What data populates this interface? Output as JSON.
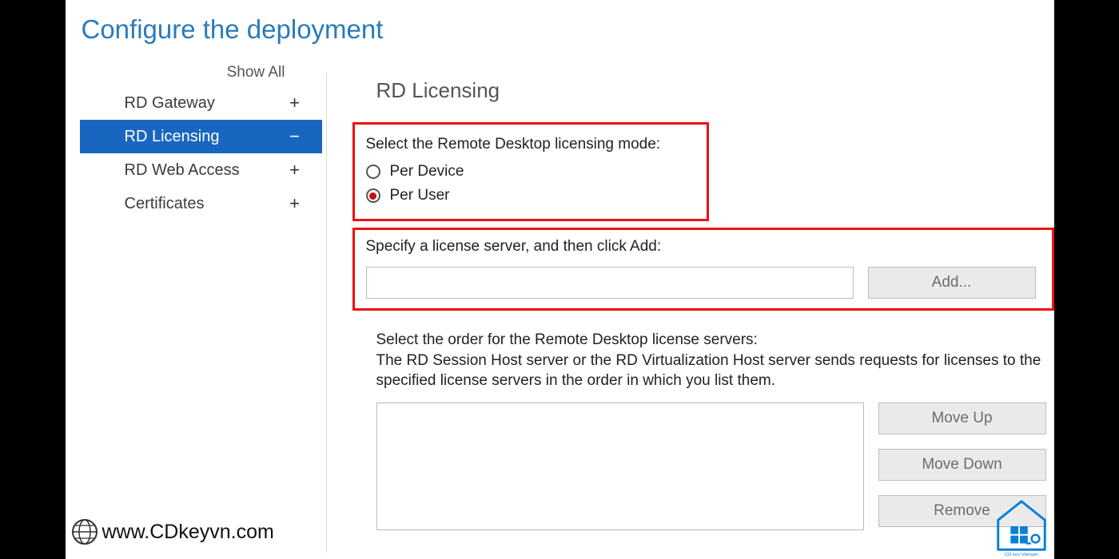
{
  "title": "Configure the deployment",
  "sidebar": {
    "show_all": "Show All",
    "items": [
      {
        "label": "RD Gateway",
        "toggle": "+",
        "active": false
      },
      {
        "label": "RD Licensing",
        "toggle": "−",
        "active": true
      },
      {
        "label": "RD Web Access",
        "toggle": "+",
        "active": false
      },
      {
        "label": "Certificates",
        "toggle": "+",
        "active": false
      }
    ]
  },
  "main": {
    "section_title": "RD Licensing",
    "mode_label": "Select the Remote Desktop licensing mode:",
    "radio_per_device": "Per Device",
    "radio_per_user": "Per User",
    "selected_mode": "Per User",
    "specify_label": "Specify a license server, and then click Add:",
    "server_input": "",
    "add_button": "Add...",
    "order_label": "Select the order for the Remote Desktop license servers:",
    "order_desc": "The RD Session Host server or the RD Virtualization Host server sends requests for licenses to the specified license servers in the order in which you list them.",
    "move_up": "Move Up",
    "move_down": "Move Down",
    "remove": "Remove"
  },
  "watermark": "www.CDkeyvn.com",
  "logo_text": "CD key Vietnam"
}
